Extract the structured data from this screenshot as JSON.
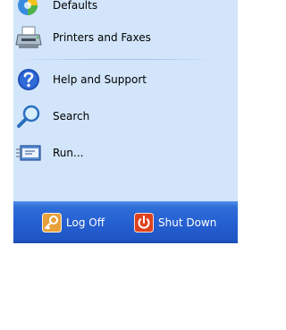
{
  "menu": {
    "items": [
      {
        "label": "Defaults",
        "icon": "default-programs-icon"
      },
      {
        "label": "Printers and Faxes",
        "icon": "printer-icon"
      },
      {
        "label": "Help and Support",
        "icon": "help-icon"
      },
      {
        "label": "Search",
        "icon": "search-icon"
      },
      {
        "label": "Run...",
        "icon": "run-icon"
      }
    ]
  },
  "footer": {
    "log_off_label": "Log Off",
    "shut_down_label": "Shut Down"
  },
  "colors": {
    "menu_background": "#d2e5fa",
    "footer_bar": "#2560d2",
    "log_off_accent": "#e8a03a",
    "shut_down_accent": "#e0421e"
  }
}
